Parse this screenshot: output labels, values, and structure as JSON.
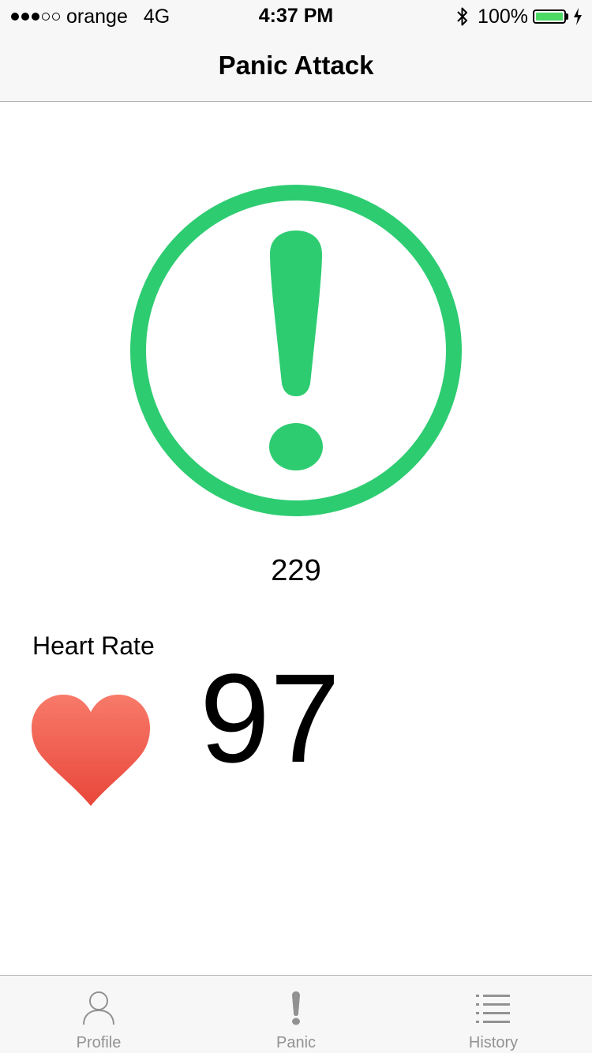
{
  "status_bar": {
    "carrier": "orange",
    "network": "4G",
    "time": "4:37 PM",
    "battery": "100%",
    "signal_filled": 3,
    "signal_total": 5
  },
  "nav": {
    "title": "Panic Attack"
  },
  "panic": {
    "icon": "exclamation-circle-icon",
    "color": "#2ecc71",
    "counter": "229"
  },
  "heart_rate": {
    "label": "Heart Rate",
    "value": "97",
    "icon": "heart-icon",
    "color": "#ee5f52"
  },
  "tab_bar": {
    "tabs": [
      {
        "label": "Profile",
        "icon": "person-icon"
      },
      {
        "label": "Panic",
        "icon": "exclamation-icon"
      },
      {
        "label": "History",
        "icon": "list-icon"
      }
    ],
    "inactive_color": "#929292"
  },
  "colors": {
    "battery_fill": "#4cd964",
    "bar_background": "#f7f7f7"
  }
}
